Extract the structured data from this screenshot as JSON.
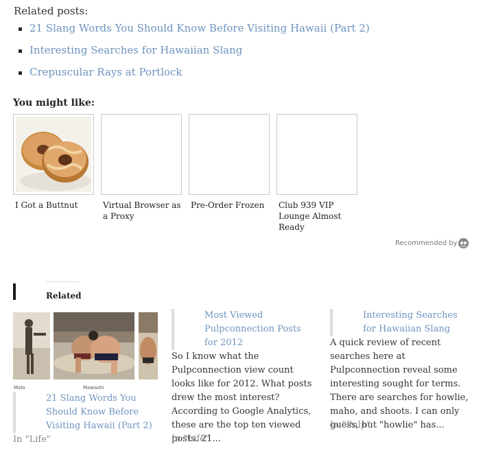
{
  "related_posts": {
    "heading": "Related posts:",
    "items": [
      {
        "label": "21 Slang Words You Should Know Before Visiting Hawaii (Part 2)"
      },
      {
        "label": "Interesting Searches for Hawaiian Slang"
      },
      {
        "label": "Crepuscular Rays at Portlock"
      }
    ]
  },
  "you_might_like": {
    "heading": "You might like:",
    "items": [
      {
        "caption": "I Got a Buttnut"
      },
      {
        "caption": "Virtual Browser as a Proxy"
      },
      {
        "caption": "Pre-Order Frozen"
      },
      {
        "caption": "Club 939 VIP Lounge Almost Ready"
      }
    ],
    "recommended_by": "Recommended by"
  },
  "related": {
    "heading": "Related",
    "thumb_captions": [
      "Malo",
      "Mawashi"
    ],
    "items": [
      {
        "title": "21 Slang Words You Should Know Before Visiting Hawaii (Part 2)",
        "category": "In \"Life\""
      },
      {
        "title": "Most Viewed Pulpconnection Posts for 2012",
        "excerpt": "So I know what the Pulpconnection view count looks like for 2012. What posts drew the most interest? According to Google Analytics, these are the top ten viewed posts. 21...",
        "category": "In \"Life\""
      },
      {
        "title": "Interesting Searches for Hawaiian Slang",
        "excerpt": "A quick review of recent searches here at Pulpconnection reveal some interesting sought for terms. There are searches for howlie, maho, and shoots. I can only guess, but \"howlie\" has...",
        "category": "In \"Pulp\""
      }
    ]
  },
  "colors": {
    "link": "#6d93be",
    "bar": "#dddddd"
  }
}
